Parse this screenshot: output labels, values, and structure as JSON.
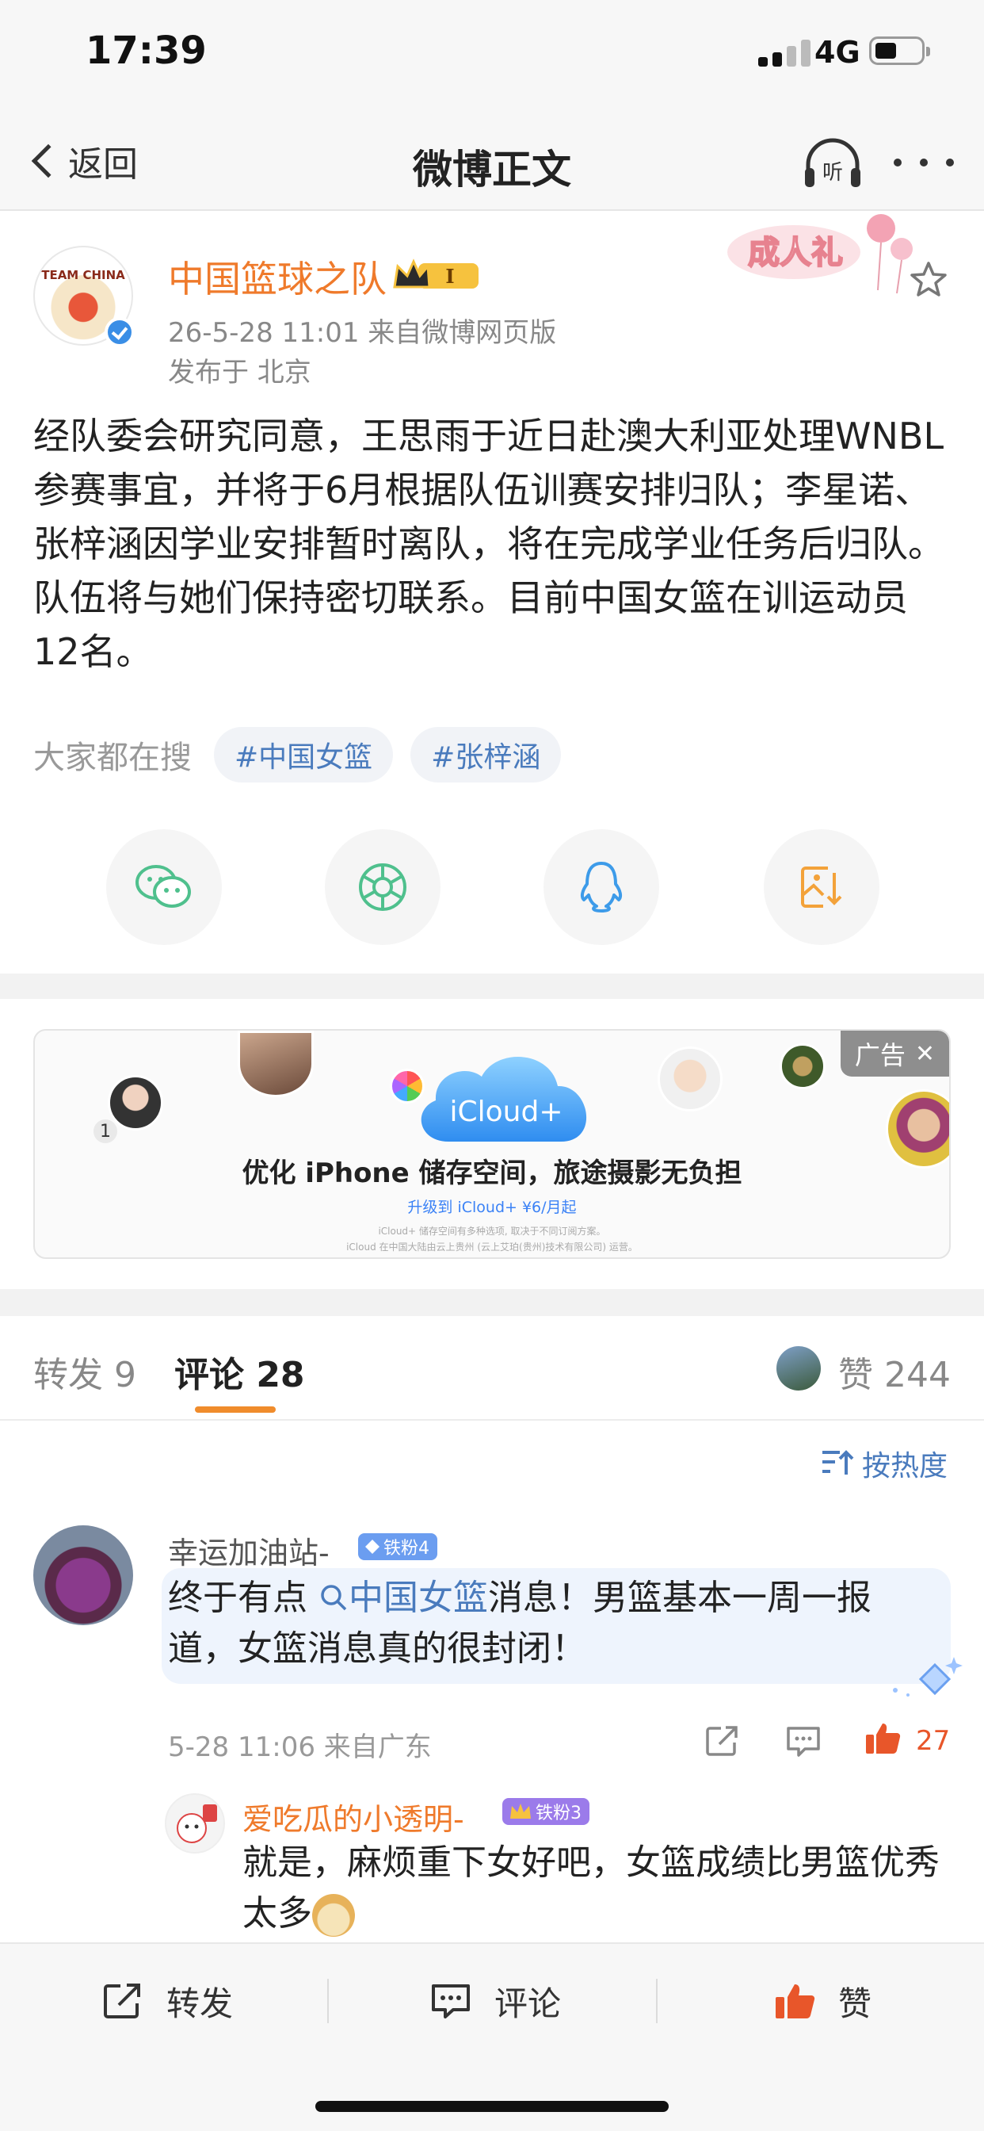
{
  "status_bar": {
    "time": "17:39",
    "network": "4G"
  },
  "nav": {
    "back_label": "返回",
    "title": "微博正文",
    "listen_icon_label": "听"
  },
  "post": {
    "avatar_team_text": "TEAM CHINA",
    "author": "中国篮球之队",
    "vip_level": "I",
    "timestamp_source": "26-5-28 11:01  来自微博网页版",
    "location": "发布于 北京",
    "badge_text": "成人礼",
    "text": "经队委会研究同意，王思雨于近日赴澳大利亚处理WNBL参赛事宜，并将于6月根据队伍训赛安排归队；李星诺、张梓涵因学业安排暂时离队，将在完成学业任务后归队。队伍将与她们保持密切联系。目前中国女篮在训运动员12名。",
    "search_label": "大家都在搜",
    "search_tags": [
      "#中国女篮",
      "#张梓涵"
    ]
  },
  "share": {
    "icons": [
      "wechat-icon",
      "moments-icon",
      "qq-icon",
      "save-image-icon"
    ]
  },
  "ad": {
    "badge": "广告",
    "close": "✕",
    "cloud_label": "iCloud+",
    "count": "1",
    "headline": "优化 iPhone 储存空间，旅途摄影无负担",
    "subline": "升级到 iCloud+ ¥6/月起",
    "note1": "iCloud+ 储存空间有多种选项, 取决于不同订阅方案。",
    "note2": "iCloud 在中国大陆由云上贵州 (云上艾珀(贵州)技术有限公司) 运营。"
  },
  "tabs": {
    "repost": "转发 9",
    "comments": "评论 28",
    "likes": "赞 244"
  },
  "sort_label": "按热度",
  "comments": [
    {
      "user": "幸运加油站-",
      "fan_badge": "铁粉4",
      "text_before": "终于有点",
      "hashtag": "中国女篮",
      "text_after": "消息！男篮基本一周一报道，女篮消息真的很封闭！",
      "meta": "5-28 11:06  来自广东",
      "likes": "27",
      "reply": {
        "user": "爱吃瓜的小透明-",
        "fan_badge": "铁粉3",
        "text": "就是，麻烦重下女好吧，女篮成绩比男篮优秀太多"
      }
    }
  ],
  "bottom_bar": {
    "repost": "转发",
    "comment": "评论",
    "like": "赞"
  },
  "colors": {
    "accent_orange": "#ef7a2b",
    "link_blue": "#4a7bbd",
    "like_red": "#e8562a",
    "fan_badge_blue": "#6b9df0",
    "fan_badge_purple": "#9b7bea"
  }
}
